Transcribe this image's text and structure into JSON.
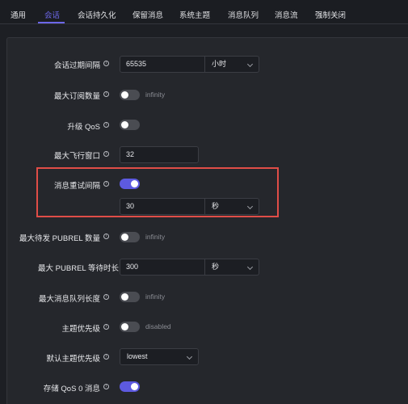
{
  "tabs": [
    {
      "label": "通用"
    },
    {
      "label": "会话"
    },
    {
      "label": "会话持久化"
    },
    {
      "label": "保留消息"
    },
    {
      "label": "系统主题"
    },
    {
      "label": "消息队列"
    },
    {
      "label": "消息流"
    },
    {
      "label": "强制关闭"
    }
  ],
  "accent_color": "#6c67e8",
  "highlight_color": "#e04d47",
  "help_icon": "info-icon",
  "settings": {
    "session_expiry": {
      "label": "会话过期间隔",
      "value": "65535",
      "unit": "小时"
    },
    "max_subscriptions": {
      "label": "最大订阅数量",
      "enabled": false,
      "hint": "infinity"
    },
    "upgrade_qos": {
      "label": "升级 QoS",
      "enabled": false
    },
    "max_inflight": {
      "label": "最大飞行窗口",
      "value": "32"
    },
    "retry_interval": {
      "label": "消息重试间隔",
      "enabled": true,
      "value": "30",
      "unit": "秒"
    },
    "max_awaiting_rel": {
      "label": "最大待发 PUBREL 数量",
      "enabled": false,
      "hint": "infinity"
    },
    "await_rel_timeout": {
      "label": "最大 PUBREL 等待时长",
      "value": "300",
      "unit": "秒"
    },
    "max_mqueue_len": {
      "label": "最大消息队列长度",
      "enabled": false,
      "hint": "infinity"
    },
    "topic_priority": {
      "label": "主题优先级",
      "enabled": false,
      "hint": "disabled"
    },
    "default_topic_priority": {
      "label": "默认主题优先级",
      "value": "lowest"
    },
    "store_qos0": {
      "label": "存储 QoS 0 消息",
      "enabled": true
    }
  }
}
